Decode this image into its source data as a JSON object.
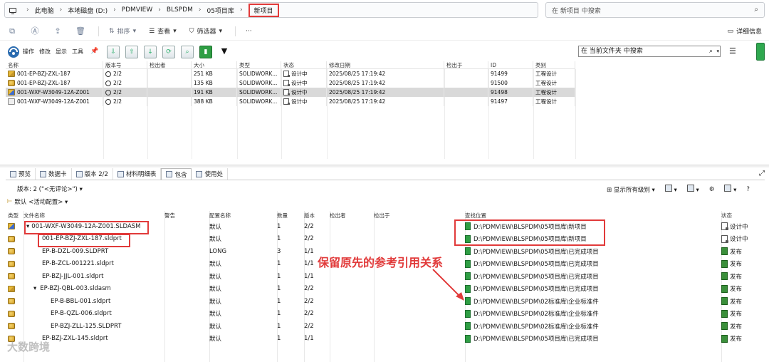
{
  "address_bar": {
    "crumbs": [
      "此电脑",
      "本地磁盘 (D:)",
      "PDMVIEW",
      "BLSPDM",
      "05项目库",
      "新项目"
    ],
    "search_placeholder": "在 新项目 中搜索"
  },
  "command_bar": {
    "sort_label": "排序",
    "view_label": "查看",
    "filter_label": "筛选器",
    "more_label": "···",
    "details_label": "详细信息"
  },
  "pdm_toolbar": {
    "labels": [
      "操作",
      "修改",
      "显示",
      "工具"
    ],
    "search_placeholder": "在 当前文件夹 中搜索"
  },
  "file_list": {
    "columns": [
      "名称",
      "版本号",
      "检出者",
      "大小",
      "类型",
      "状态",
      "修改日期",
      "检出于",
      "ID",
      "类别"
    ],
    "rows": [
      {
        "name": "001-EP-BZJ-ZXL-187",
        "version": "2/2",
        "checked_by": "",
        "size": "251 KB",
        "type": "SOLIDWORK...",
        "state": "设计中",
        "modified": "2025/08/25 17:19:42",
        "checked_at": "",
        "id": "91499",
        "category": "工程设计",
        "icon": "assembly-icon",
        "selected": false
      },
      {
        "name": "001-EP-BZJ-ZXL-187",
        "version": "2/2",
        "checked_by": "",
        "size": "135 KB",
        "type": "SOLIDWORK...",
        "state": "设计中",
        "modified": "2025/08/25 17:19:42",
        "checked_at": "",
        "id": "91500",
        "category": "工程设计",
        "icon": "part-icon",
        "selected": false
      },
      {
        "name": "001-WXF-W3049-12A-Z001",
        "version": "2/2",
        "checked_by": "",
        "size": "191 KB",
        "type": "SOLIDWORK...",
        "state": "设计中",
        "modified": "2025/08/25 17:19:42",
        "checked_at": "",
        "id": "91498",
        "category": "工程设计",
        "icon": "assembly-icon",
        "selected": true
      },
      {
        "name": "001-WXF-W3049-12A-Z001",
        "version": "2/2",
        "checked_by": "",
        "size": "388 KB",
        "type": "SOLIDWORK...",
        "state": "设计中",
        "modified": "2025/08/25 17:19:42",
        "checked_at": "",
        "id": "91497",
        "category": "工程设计",
        "icon": "drawing-icon",
        "selected": false
      }
    ]
  },
  "tabs": [
    {
      "label": "预览",
      "active": false
    },
    {
      "label": "数据卡",
      "active": false
    },
    {
      "label": "版本 2/2",
      "active": false
    },
    {
      "label": "材料明细表",
      "active": false
    },
    {
      "label": "包含",
      "active": true
    },
    {
      "label": "使用处",
      "active": false
    }
  ],
  "contains_panel": {
    "version_line": "版本: 2 (\"<无评论>\") ▾",
    "config_line": "默认 <活动配置> ▾",
    "show_levels_label": "显示所有级别"
  },
  "tree": {
    "columns": [
      "类型",
      "文件名称",
      "警告",
      "配置名称",
      "数量",
      "版本",
      "检出者",
      "检出于",
      "查找位置",
      "状态"
    ],
    "rows": [
      {
        "file": "001-WXF-W3049-12A-Z001.SLDASM",
        "level": 0,
        "toggle": "▾",
        "config": "默认",
        "qty": "1",
        "version": "2/2",
        "location": "D:\\PDMVIEW\\BLSPDM\\05项目库\\新项目",
        "state": "设计中",
        "type": "assembly"
      },
      {
        "file": "001-EP-BZJ-ZXL-187.sldprt",
        "level": 1,
        "toggle": "",
        "config": "默认",
        "qty": "1",
        "version": "2/2",
        "location": "D:\\PDMVIEW\\BLSPDM\\05项目库\\新项目",
        "state": "设计中",
        "type": "part"
      },
      {
        "file": "EP-B-DZL-009.SLDPRT",
        "level": 1,
        "toggle": "",
        "config": "LONG",
        "qty": "3",
        "version": "1/1",
        "location": "D:\\PDMVIEW\\BLSPDM\\05项目库\\已完成项目",
        "state": "发布",
        "type": "part"
      },
      {
        "file": "EP-B-ZCL-001221.sldprt",
        "level": 1,
        "toggle": "",
        "config": "默认",
        "qty": "1",
        "version": "1/1",
        "location": "D:\\PDMVIEW\\BLSPDM\\05项目库\\已完成项目",
        "state": "发布",
        "type": "part"
      },
      {
        "file": "EP-BZJ-JJL-001.sldprt",
        "level": 1,
        "toggle": "",
        "config": "默认",
        "qty": "1",
        "version": "1/1",
        "location": "D:\\PDMVIEW\\BLSPDM\\05项目库\\已完成项目",
        "state": "发布",
        "type": "part"
      },
      {
        "file": "EP-BZJ-QBL-003.sldasm",
        "level": 1,
        "toggle": "▾",
        "config": "默认",
        "qty": "1",
        "version": "2/2",
        "location": "D:\\PDMVIEW\\BLSPDM\\05项目库\\已完成项目",
        "state": "发布",
        "type": "assembly"
      },
      {
        "file": "EP-B-BBL-001.sldprt",
        "level": 2,
        "toggle": "",
        "config": "默认",
        "qty": "1",
        "version": "2/2",
        "location": "D:\\PDMVIEW\\BLSPDM\\02标准库\\企业标准件",
        "state": "发布",
        "type": "part"
      },
      {
        "file": "EP-B-QZL-006.sldprt",
        "level": 2,
        "toggle": "",
        "config": "默认",
        "qty": "1",
        "version": "2/2",
        "location": "D:\\PDMVIEW\\BLSPDM\\02标准库\\企业标准件",
        "state": "发布",
        "type": "part"
      },
      {
        "file": "EP-BZJ-ZLL-125.SLDPRT",
        "level": 2,
        "toggle": "",
        "config": "默认",
        "qty": "1",
        "version": "2/2",
        "location": "D:\\PDMVIEW\\BLSPDM\\02标准库\\企业标准件",
        "state": "发布",
        "type": "part"
      },
      {
        "file": "EP-BZJ-ZXL-145.sldprt",
        "level": 1,
        "toggle": "",
        "config": "默认",
        "qty": "1",
        "version": "1/1",
        "location": "D:\\PDMVIEW\\BLSPDM\\05项目库\\已完成项目",
        "state": "发布",
        "type": "part"
      }
    ]
  },
  "annotation": {
    "text": "保留原先的参考引用关系",
    "color": "#e13a3a"
  },
  "watermark": "大数跨境"
}
